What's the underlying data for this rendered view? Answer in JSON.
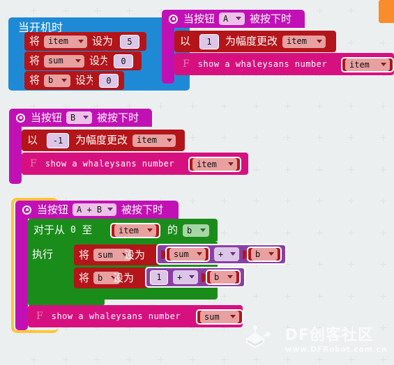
{
  "canvas": {
    "background_color": "#eceff0",
    "grid_color": "#dfe3e4",
    "accent_selected_color": "#fcc537",
    "orange_tab_color": "#fb8c2b"
  },
  "watermark": {
    "title": "DF创客社区",
    "url": "www.DFRobot.com.cn",
    "logo_icon": "robot-logo-icon"
  },
  "blocks": {
    "on_start": {
      "hat_label": "当开机时",
      "color": "#1e8ad6",
      "statements": [
        {
          "set_label": "将",
          "variable": "item",
          "to_label": "设为",
          "value": "5"
        },
        {
          "set_label": "将",
          "variable": "sum",
          "to_label": "设为",
          "value": "0"
        },
        {
          "set_label": "将",
          "variable": "b",
          "to_label": "设为",
          "value": "0"
        }
      ]
    },
    "on_button_a": {
      "hat_prefix": "当按钮",
      "button": "A",
      "hat_suffix": "被按下时",
      "color": "#c111b5",
      "change_by": {
        "prefix": "以",
        "value": "1",
        "middle": "为幅度更改",
        "variable": "item"
      },
      "show_number": {
        "icon": "F",
        "label": "show a whaleysans number",
        "variable": "item"
      }
    },
    "on_button_b": {
      "hat_prefix": "当按钮",
      "button": "B",
      "hat_suffix": "被按下时",
      "color": "#c111b5",
      "change_by": {
        "prefix": "以",
        "value": "-1",
        "middle": "为幅度更改",
        "variable": "item"
      },
      "show_number": {
        "icon": "F",
        "label": "show a whaleysans number",
        "variable": "item"
      }
    },
    "on_button_ab": {
      "hat_prefix": "当按钮",
      "button": "A + B",
      "hat_suffix": "被按下时",
      "color": "#c111b5",
      "selected": true,
      "for_loop": {
        "from_label": "对于从",
        "from_value": "0",
        "to_label": "至",
        "to_variable": "item",
        "of_label": "的",
        "index_variable": "b",
        "do_label": "执行",
        "color": "#1a8c1a",
        "body": [
          {
            "set_label": "将",
            "variable": "sum",
            "to_label": "设为",
            "expression": {
              "left": "sum",
              "operator": "+",
              "right": "b"
            }
          },
          {
            "set_label": "将",
            "variable": "b",
            "to_label": "设为",
            "expression": {
              "left": "1",
              "operator": "+",
              "right": "b"
            }
          }
        ]
      },
      "show_number": {
        "icon": "F",
        "label": "show a whaleysans number",
        "variable": "sum"
      }
    }
  }
}
